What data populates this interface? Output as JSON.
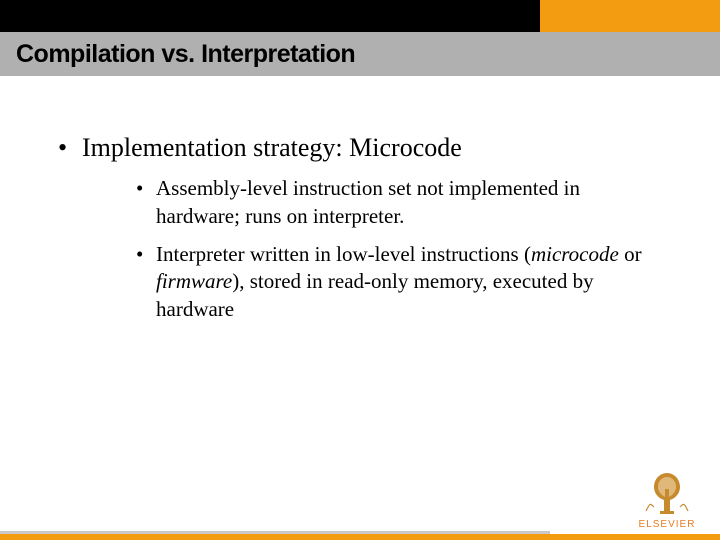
{
  "title": "Compilation vs. Interpretation",
  "bullet": {
    "lead": "Implementation strategy:",
    "topic": " Microcode"
  },
  "sub": [
    {
      "text": "Assembly-level instruction set not implemented in hardware; runs on interpreter."
    },
    {
      "pre": "Interpreter written in low-level instructions (",
      "em1": "microcode",
      "mid": " or ",
      "em2": "firmware",
      "post": "), stored in read-only memory, executed by hardware"
    }
  ],
  "publisher": "ELSEVIER",
  "colors": {
    "orange": "#f39c12",
    "gray": "#b0b0b0"
  }
}
